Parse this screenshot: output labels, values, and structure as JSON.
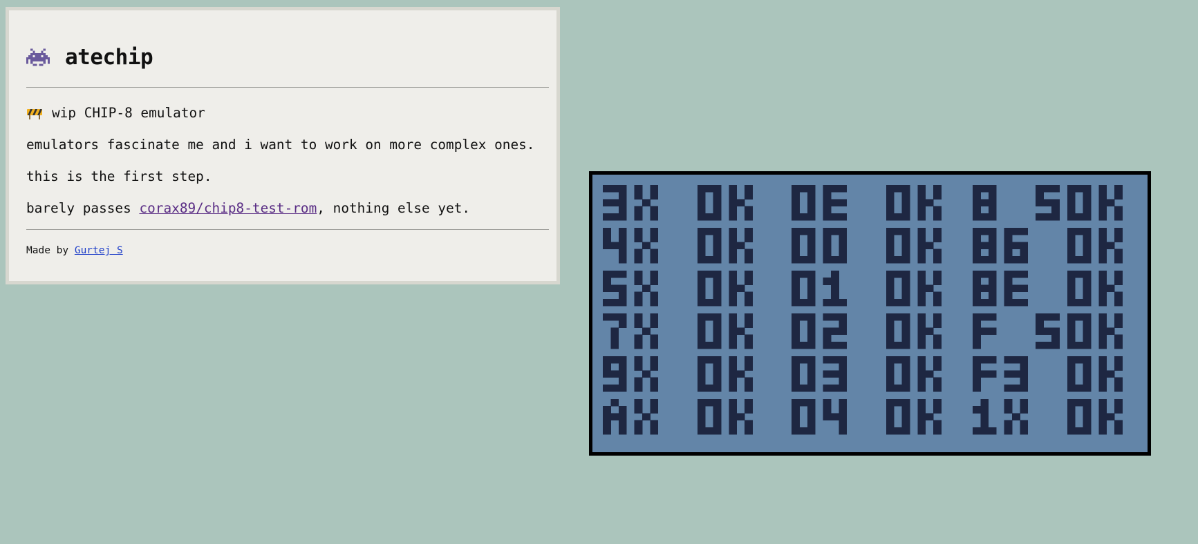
{
  "app": {
    "title": "atechip",
    "title_icon": "alien-monster-icon"
  },
  "intro": {
    "wip_icon": "construction-barrier-icon",
    "headline": "wip CHIP-8 emulator",
    "paragraph1": "emulators fascinate me and i want to work on more complex ones.",
    "paragraph2": "this is the first step.",
    "paragraph3_before": "barely passes ",
    "paragraph3_link": "corax89/chip8-test-rom",
    "paragraph3_after": ", nothing else yet."
  },
  "footer": {
    "made_by": "Made by ",
    "author": "Gurtej S"
  },
  "screen": {
    "background": "#6385a8",
    "foreground": "#1e2742",
    "columns": [
      [
        "3X",
        "4X",
        "5X",
        "7X",
        "9X",
        "AX"
      ],
      [
        "0E",
        "00",
        "01",
        "02",
        "03",
        "04"
      ],
      [
        "8 5",
        "86",
        "8E",
        "F 5",
        "F3",
        "1X"
      ]
    ],
    "status": "OK"
  },
  "colors": {
    "page_background": "#abc5bc",
    "card_background": "#efeeea",
    "link_visited": "#5a2d85",
    "link": "#1f3fc9"
  }
}
